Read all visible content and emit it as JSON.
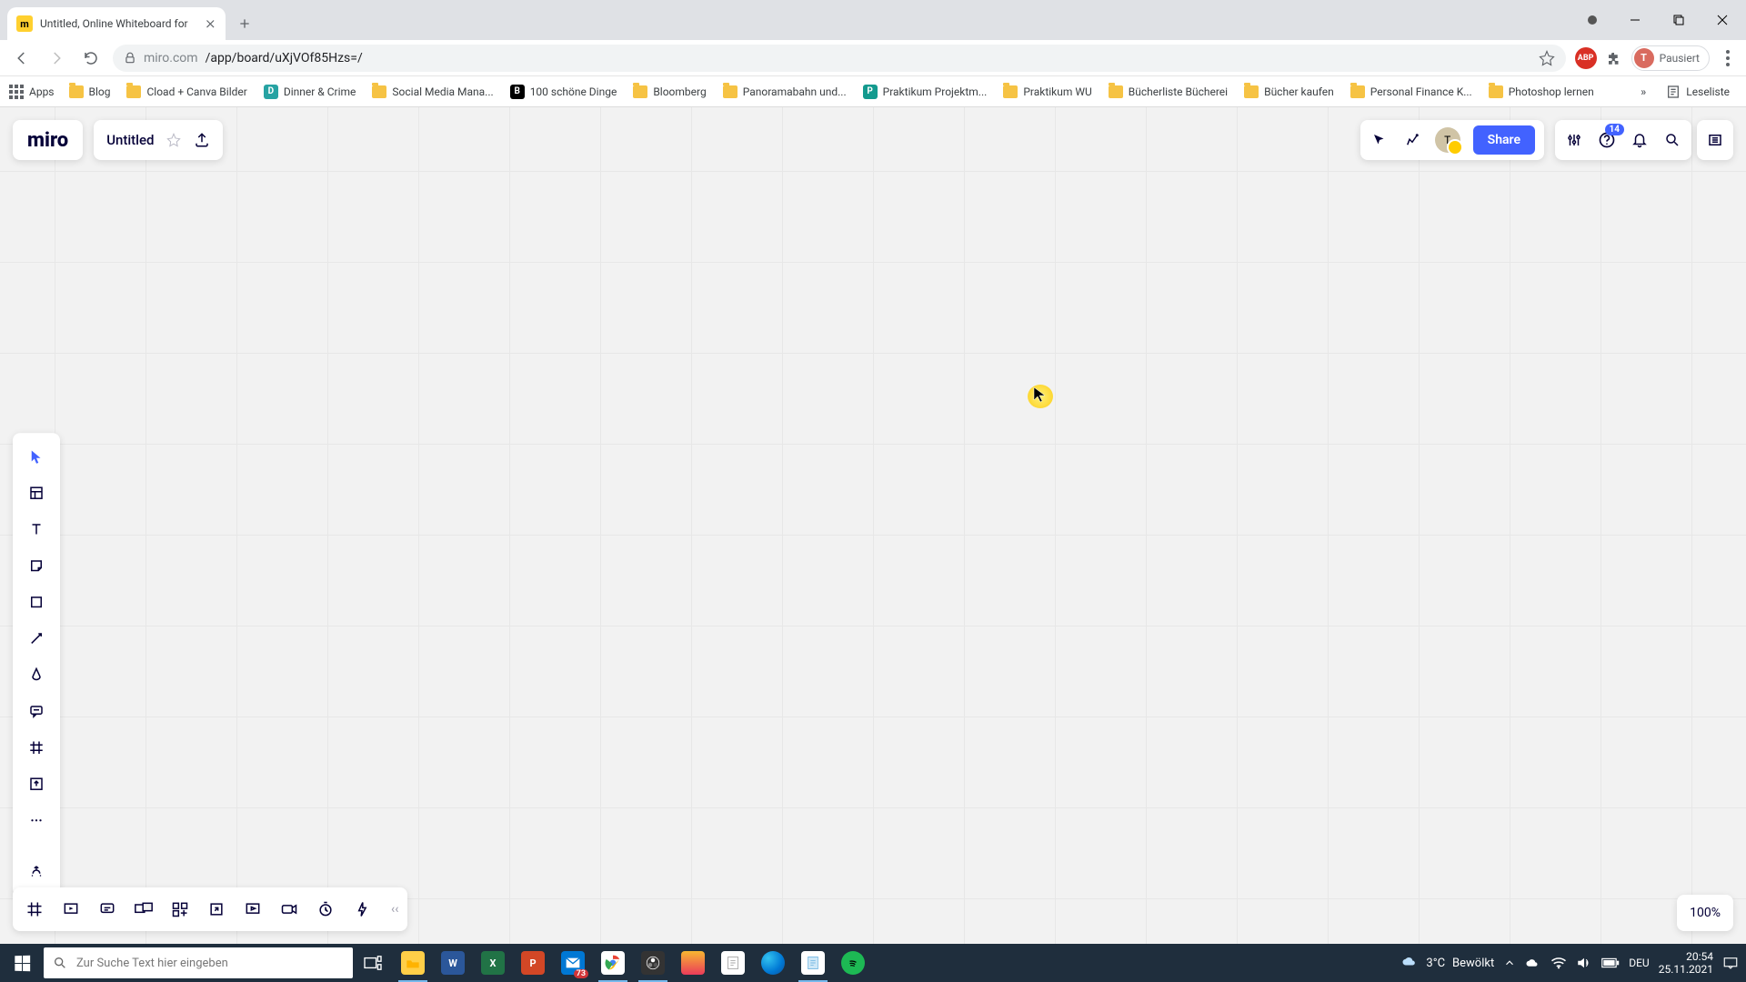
{
  "browser": {
    "tab_title": "Untitled, Online Whiteboard for",
    "url_host": "miro.com",
    "url_path": "/app/board/uXjVOf85Hzs=/",
    "profile_status": "Pausiert",
    "profile_initial": "T",
    "ext_abp": "ABP",
    "apps_label": "Apps",
    "bookmarks": [
      {
        "label": "Blog",
        "kind": "folder"
      },
      {
        "label": "Cload + Canva Bilder",
        "kind": "folder"
      },
      {
        "label": "Dinner & Crime",
        "kind": "icon",
        "bg": "#27a3a3",
        "initial": "D"
      },
      {
        "label": "Social Media Mana...",
        "kind": "folder"
      },
      {
        "label": "100 schöne Dinge",
        "kind": "icon",
        "bg": "#000",
        "initial": "B"
      },
      {
        "label": "Bloomberg",
        "kind": "folder"
      },
      {
        "label": "Panoramabahn und...",
        "kind": "folder"
      },
      {
        "label": "Praktikum Projektm...",
        "kind": "icon",
        "bg": "#139a8e",
        "initial": "P"
      },
      {
        "label": "Praktikum WU",
        "kind": "folder"
      },
      {
        "label": "Bücherliste Bücherei",
        "kind": "folder"
      },
      {
        "label": "Bücher kaufen",
        "kind": "folder"
      },
      {
        "label": "Personal Finance K...",
        "kind": "folder"
      },
      {
        "label": "Photoshop lernen",
        "kind": "folder"
      }
    ],
    "overflow_label": "»",
    "readlist_label": "Leseliste"
  },
  "miro": {
    "logo": "miro",
    "board_title": "Untitled",
    "share_label": "Share",
    "help_badge": "14",
    "avatar_initial": "T",
    "zoom": "100%",
    "left_tools": [
      "select",
      "templates",
      "text",
      "sticky",
      "shape",
      "line",
      "pen",
      "comment",
      "frame",
      "upload",
      "more"
    ],
    "plugin_tool": "apps",
    "bottom_tools": [
      "frames",
      "present",
      "comments",
      "screenshare",
      "activities",
      "export",
      "embed",
      "screen-record",
      "timer",
      "reactions"
    ]
  },
  "taskbar": {
    "search_placeholder": "Zur Suche Text hier eingeben",
    "weather_temp": "3°C",
    "weather_desc": "Bewölkt",
    "lang": "DEU",
    "time": "20:54",
    "date": "25.11.2021",
    "mail_badge": "73"
  }
}
